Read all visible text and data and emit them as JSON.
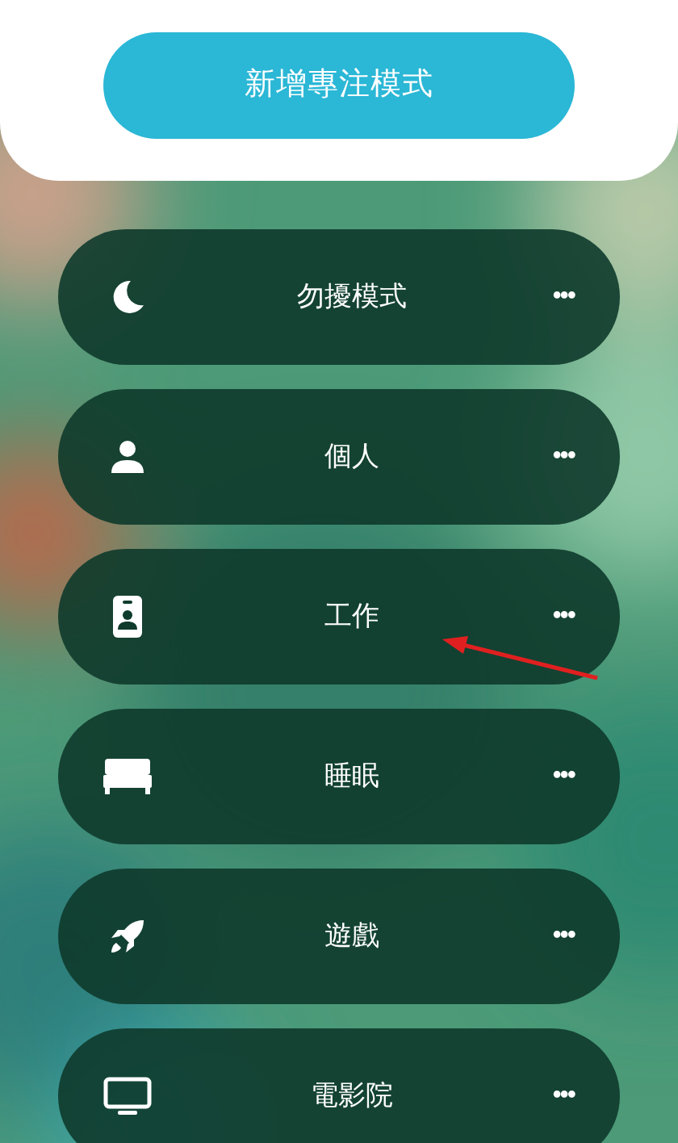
{
  "add_button": {
    "label": "新增專注模式"
  },
  "focus_modes": [
    {
      "label": "勿擾模式",
      "more": "•••"
    },
    {
      "label": "個人",
      "more": "•••"
    },
    {
      "label": "工作",
      "more": "•••"
    },
    {
      "label": "睡眠",
      "more": "•••"
    },
    {
      "label": "遊戲",
      "more": "•••"
    },
    {
      "label": "電影院",
      "more": "•••"
    }
  ]
}
